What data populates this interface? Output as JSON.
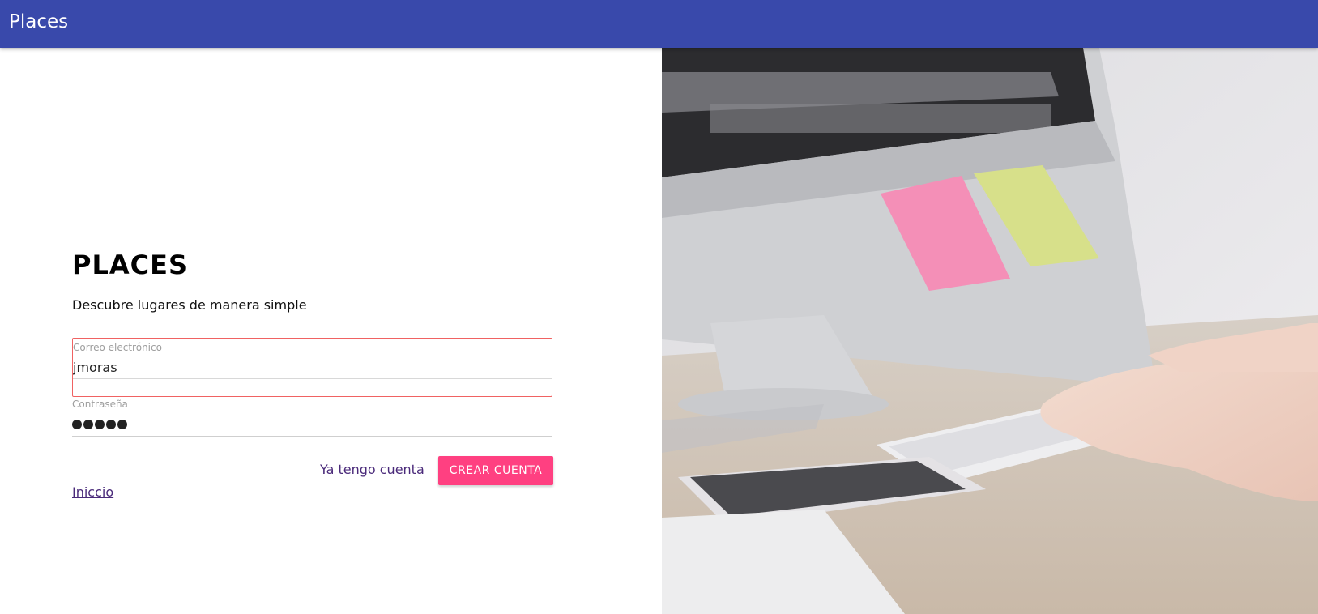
{
  "appbar": {
    "title": "Places",
    "color": "#3949ab"
  },
  "hero": {
    "title": "PLACES",
    "subtitle": "Descubre lugares de manera simple"
  },
  "form": {
    "email": {
      "label": "Correo electrónico",
      "value": "jmoras"
    },
    "password": {
      "label": "Contraseña",
      "masked_length": 5
    },
    "have_account_link": "Ya tengo cuenta",
    "create_button": "CREAR CUENTA",
    "home_link": "Iniccio"
  },
  "colors": {
    "accent": "#ff4081",
    "error_border": "#f06262",
    "link": "#4a2a7a"
  }
}
